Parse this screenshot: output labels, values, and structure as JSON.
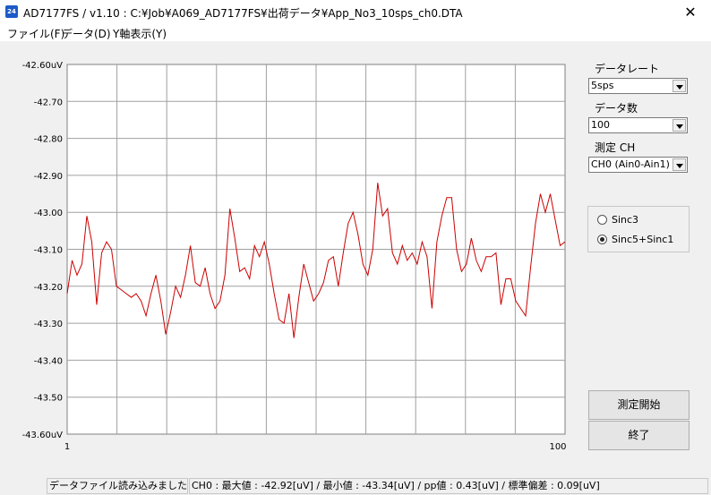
{
  "window": {
    "icon_text": "24",
    "title": "AD7177FS / v1.10 : C:¥Job¥A069_AD7177FS¥出荷データ¥App_No3_10sps_ch0.DTA",
    "close_glyph": "✕"
  },
  "menu": [
    "ファイル(F)",
    "データ(D)",
    "Y軸表示(Y)"
  ],
  "side": {
    "data_rate_label": "データレート",
    "data_rate_value": "5sps",
    "data_count_label": "データ数",
    "data_count_value": "100",
    "channel_label": "測定 CH",
    "channel_value": "CH0 (Ain0-Ain1)",
    "filters": [
      {
        "label": "Sinc3",
        "checked": false
      },
      {
        "label": "Sinc5+Sinc1",
        "checked": true
      }
    ],
    "start_button": "測定開始",
    "exit_button": "終了"
  },
  "status": {
    "message": "データファイル読み込みました",
    "stats": "CH0 : 最大値 : -42.92[uV] / 最小値 : -43.34[uV] / pp値 : 0.43[uV] / 標準偏差 : 0.09[uV]"
  },
  "chart_data": {
    "type": "line",
    "y_tick_labels": [
      "-42.60uV",
      "-42.70",
      "-42.80",
      "-42.90",
      "-43.00",
      "-43.10",
      "-43.20",
      "-43.30",
      "-43.40",
      "-43.50",
      "-43.60uV"
    ],
    "x_tick_labels": [
      "1",
      "100"
    ],
    "ylim": [
      -43.6,
      -42.6
    ],
    "xlim": [
      1,
      100
    ],
    "grid": true,
    "series_color": "#cc0000",
    "series": [
      {
        "values": [
          -43.22,
          -43.13,
          -43.17,
          -43.14,
          -43.01,
          -43.08,
          -43.25,
          -43.11,
          -43.08,
          -43.1,
          -43.2,
          -43.21,
          -43.22,
          -43.23,
          -43.22,
          -43.24,
          -43.28,
          -43.22,
          -43.17,
          -43.24,
          -43.33,
          -43.27,
          -43.2,
          -43.23,
          -43.17,
          -43.09,
          -43.19,
          -43.2,
          -43.15,
          -43.22,
          -43.26,
          -43.24,
          -43.17,
          -42.99,
          -43.07,
          -43.16,
          -43.15,
          -43.18,
          -43.09,
          -43.12,
          -43.08,
          -43.14,
          -43.22,
          -43.29,
          -43.3,
          -43.22,
          -43.34,
          -43.23,
          -43.14,
          -43.19,
          -43.24,
          -43.22,
          -43.19,
          -43.13,
          -43.12,
          -43.2,
          -43.11,
          -43.03,
          -43.0,
          -43.06,
          -43.14,
          -43.17,
          -43.1,
          -42.92,
          -43.01,
          -42.99,
          -43.11,
          -43.14,
          -43.09,
          -43.13,
          -43.11,
          -43.14,
          -43.08,
          -43.12,
          -43.26,
          -43.08,
          -43.01,
          -42.96,
          -42.96,
          -43.1,
          -43.16,
          -43.14,
          -43.07,
          -43.13,
          -43.16,
          -43.12,
          -43.12,
          -43.11,
          -43.25,
          -43.18,
          -43.18,
          -43.24,
          -43.26,
          -43.28,
          -43.15,
          -43.03,
          -42.95,
          -43.0,
          -42.95,
          -43.02,
          -43.09,
          -43.08
        ]
      }
    ]
  }
}
